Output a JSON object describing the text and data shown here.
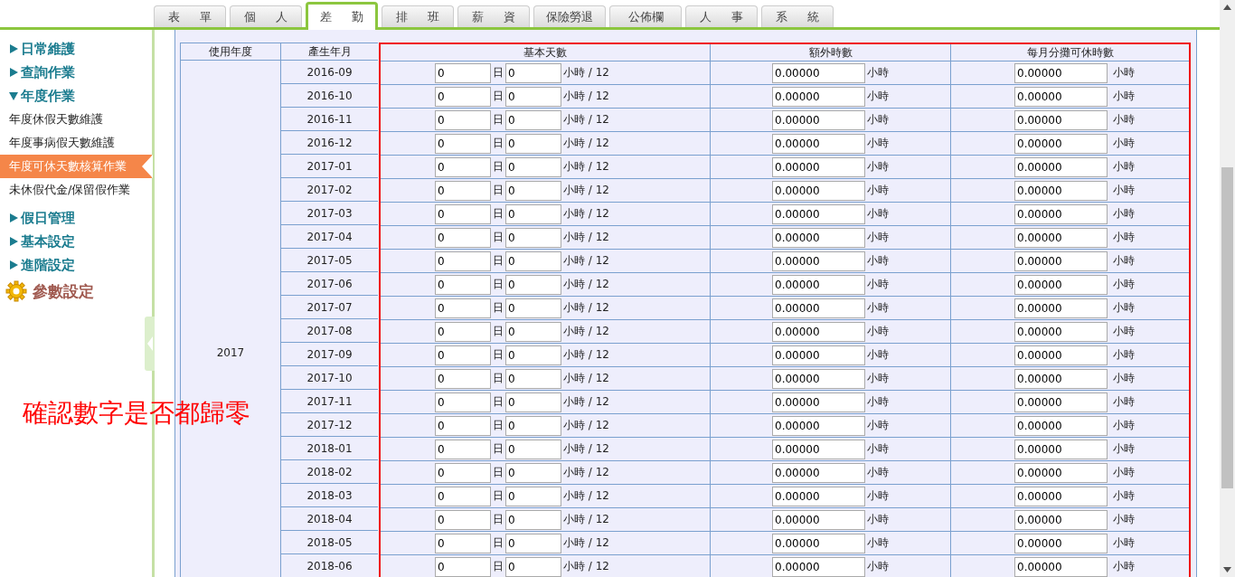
{
  "tabs": [
    {
      "label": "表 單",
      "selected": false
    },
    {
      "label": "個 人",
      "selected": false
    },
    {
      "label": "差 勤",
      "selected": true
    },
    {
      "label": "排 班",
      "selected": false
    },
    {
      "label": "薪 資",
      "selected": false
    },
    {
      "label": "保險勞退",
      "selected": false
    },
    {
      "label": "公佈欄",
      "selected": false
    },
    {
      "label": "人 事",
      "selected": false
    },
    {
      "label": "系 統",
      "selected": false
    }
  ],
  "sidebar": {
    "items": [
      {
        "kind": "section",
        "label": "日常維護",
        "expanded": false
      },
      {
        "kind": "section",
        "label": "查詢作業",
        "expanded": false
      },
      {
        "kind": "section",
        "label": "年度作業",
        "expanded": true,
        "children": [
          {
            "label": "年度休假天數維護",
            "selected": false
          },
          {
            "label": "年度事病假天數維護",
            "selected": false
          },
          {
            "label": "年度可休天數核算作業",
            "selected": true
          },
          {
            "label": "未休假代金/保留假作業",
            "selected": false
          }
        ]
      },
      {
        "kind": "section",
        "label": "假日管理",
        "expanded": false
      },
      {
        "kind": "section",
        "label": "基本設定",
        "expanded": false
      },
      {
        "kind": "section",
        "label": "進階設定",
        "expanded": false
      },
      {
        "kind": "gear",
        "label": "參數設定"
      }
    ]
  },
  "table": {
    "columns": [
      "使用年度",
      "產生年月",
      "基本天數",
      "額外時數",
      "每月分攤可休時數"
    ],
    "year": "2017",
    "rows": [
      {
        "month": "2016-09",
        "days": "0",
        "day_unit": "日",
        "hours": "0",
        "hours_unit": "小時 / 12",
        "extra": "0.00000",
        "extra_unit": "小時",
        "monthly": "0.00000",
        "monthly_unit": "小時"
      },
      {
        "month": "2016-10",
        "days": "0",
        "day_unit": "日",
        "hours": "0",
        "hours_unit": "小時 / 12",
        "extra": "0.00000",
        "extra_unit": "小時",
        "monthly": "0.00000",
        "monthly_unit": "小時"
      },
      {
        "month": "2016-11",
        "days": "0",
        "day_unit": "日",
        "hours": "0",
        "hours_unit": "小時 / 12",
        "extra": "0.00000",
        "extra_unit": "小時",
        "monthly": "0.00000",
        "monthly_unit": "小時"
      },
      {
        "month": "2016-12",
        "days": "0",
        "day_unit": "日",
        "hours": "0",
        "hours_unit": "小時 / 12",
        "extra": "0.00000",
        "extra_unit": "小時",
        "monthly": "0.00000",
        "monthly_unit": "小時"
      },
      {
        "month": "2017-01",
        "days": "0",
        "day_unit": "日",
        "hours": "0",
        "hours_unit": "小時 / 12",
        "extra": "0.00000",
        "extra_unit": "小時",
        "monthly": "0.00000",
        "monthly_unit": "小時"
      },
      {
        "month": "2017-02",
        "days": "0",
        "day_unit": "日",
        "hours": "0",
        "hours_unit": "小時 / 12",
        "extra": "0.00000",
        "extra_unit": "小時",
        "monthly": "0.00000",
        "monthly_unit": "小時"
      },
      {
        "month": "2017-03",
        "days": "0",
        "day_unit": "日",
        "hours": "0",
        "hours_unit": "小時 / 12",
        "extra": "0.00000",
        "extra_unit": "小時",
        "monthly": "0.00000",
        "monthly_unit": "小時"
      },
      {
        "month": "2017-04",
        "days": "0",
        "day_unit": "日",
        "hours": "0",
        "hours_unit": "小時 / 12",
        "extra": "0.00000",
        "extra_unit": "小時",
        "monthly": "0.00000",
        "monthly_unit": "小時"
      },
      {
        "month": "2017-05",
        "days": "0",
        "day_unit": "日",
        "hours": "0",
        "hours_unit": "小時 / 12",
        "extra": "0.00000",
        "extra_unit": "小時",
        "monthly": "0.00000",
        "monthly_unit": "小時"
      },
      {
        "month": "2017-06",
        "days": "0",
        "day_unit": "日",
        "hours": "0",
        "hours_unit": "小時 / 12",
        "extra": "0.00000",
        "extra_unit": "小時",
        "monthly": "0.00000",
        "monthly_unit": "小時"
      },
      {
        "month": "2017-07",
        "days": "0",
        "day_unit": "日",
        "hours": "0",
        "hours_unit": "小時 / 12",
        "extra": "0.00000",
        "extra_unit": "小時",
        "monthly": "0.00000",
        "monthly_unit": "小時"
      },
      {
        "month": "2017-08",
        "days": "0",
        "day_unit": "日",
        "hours": "0",
        "hours_unit": "小時 / 12",
        "extra": "0.00000",
        "extra_unit": "小時",
        "monthly": "0.00000",
        "monthly_unit": "小時"
      },
      {
        "month": "2017-09",
        "days": "0",
        "day_unit": "日",
        "hours": "0",
        "hours_unit": "小時 / 12",
        "extra": "0.00000",
        "extra_unit": "小時",
        "monthly": "0.00000",
        "monthly_unit": "小時"
      },
      {
        "month": "2017-10",
        "days": "0",
        "day_unit": "日",
        "hours": "0",
        "hours_unit": "小時 / 12",
        "extra": "0.00000",
        "extra_unit": "小時",
        "monthly": "0.00000",
        "monthly_unit": "小時"
      },
      {
        "month": "2017-11",
        "days": "0",
        "day_unit": "日",
        "hours": "0",
        "hours_unit": "小時 / 12",
        "extra": "0.00000",
        "extra_unit": "小時",
        "monthly": "0.00000",
        "monthly_unit": "小時"
      },
      {
        "month": "2017-12",
        "days": "0",
        "day_unit": "日",
        "hours": "0",
        "hours_unit": "小時 / 12",
        "extra": "0.00000",
        "extra_unit": "小時",
        "monthly": "0.00000",
        "monthly_unit": "小時"
      },
      {
        "month": "2018-01",
        "days": "0",
        "day_unit": "日",
        "hours": "0",
        "hours_unit": "小時 / 12",
        "extra": "0.00000",
        "extra_unit": "小時",
        "monthly": "0.00000",
        "monthly_unit": "小時"
      },
      {
        "month": "2018-02",
        "days": "0",
        "day_unit": "日",
        "hours": "0",
        "hours_unit": "小時 / 12",
        "extra": "0.00000",
        "extra_unit": "小時",
        "monthly": "0.00000",
        "monthly_unit": "小時"
      },
      {
        "month": "2018-03",
        "days": "0",
        "day_unit": "日",
        "hours": "0",
        "hours_unit": "小時 / 12",
        "extra": "0.00000",
        "extra_unit": "小時",
        "monthly": "0.00000",
        "monthly_unit": "小時"
      },
      {
        "month": "2018-04",
        "days": "0",
        "day_unit": "日",
        "hours": "0",
        "hours_unit": "小時 / 12",
        "extra": "0.00000",
        "extra_unit": "小時",
        "monthly": "0.00000",
        "monthly_unit": "小時"
      },
      {
        "month": "2018-05",
        "days": "0",
        "day_unit": "日",
        "hours": "0",
        "hours_unit": "小時 / 12",
        "extra": "0.00000",
        "extra_unit": "小時",
        "monthly": "0.00000",
        "monthly_unit": "小時"
      },
      {
        "month": "2018-06",
        "days": "0",
        "day_unit": "日",
        "hours": "0",
        "hours_unit": "小時 / 12",
        "extra": "0.00000",
        "extra_unit": "小時",
        "monthly": "0.00000",
        "monthly_unit": "小時"
      }
    ]
  },
  "annotation": "確認數字是否都歸零"
}
